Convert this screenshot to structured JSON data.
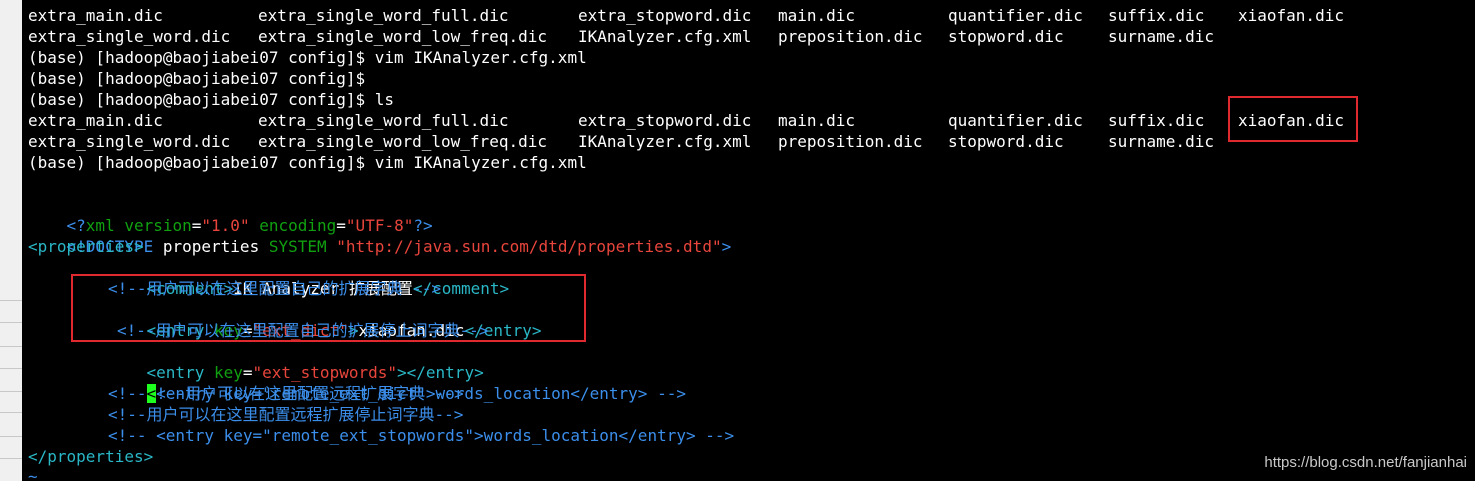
{
  "terminal": {
    "listing_1": {
      "row1": [
        "extra_main.dic",
        "extra_single_word_full.dic",
        "extra_stopword.dic",
        "main.dic",
        "quantifier.dic",
        "suffix.dic",
        "xiaofan.dic"
      ],
      "row2": [
        "extra_single_word.dic",
        "extra_single_word_low_freq.dic",
        "IKAnalyzer.cfg.xml",
        "preposition.dic",
        "stopword.dic",
        "surname.dic"
      ]
    },
    "prompt_1": "(base) [hadoop@baojiabei07 config]$ vim IKAnalyzer.cfg.xml",
    "prompt_2": "(base) [hadoop@baojiabei07 config]$",
    "prompt_3": "(base) [hadoop@baojiabei07 config]$ ls",
    "listing_2": {
      "row1": [
        "extra_main.dic",
        "extra_single_word_full.dic",
        "extra_stopword.dic",
        "main.dic",
        "quantifier.dic",
        "suffix.dic",
        "xiaofan.dic"
      ],
      "row2": [
        "extra_single_word.dic",
        "extra_single_word_low_freq.dic",
        "IKAnalyzer.cfg.xml",
        "preposition.dic",
        "stopword.dic",
        "surname.dic"
      ]
    },
    "prompt_4": "(base) [hadoop@baojiabei07 config]$ vim IKAnalyzer.cfg.xml"
  },
  "vim": {
    "xml_decl": {
      "open": "<?",
      "name": "xml",
      "attr1_name": " version",
      "eq": "=",
      "attr1_value": "\"1.0\"",
      "attr2_name": " encoding",
      "attr2_value": "\"UTF-8\"",
      "close": "?>"
    },
    "doctype": {
      "open": "<!DOCTYPE",
      "text": " properties ",
      "keyword": "SYSTEM",
      "space": " ",
      "url": "\"http://java.sun.com/dtd/properties.dtd\"",
      "close": ">"
    },
    "properties_open": "<properties>",
    "comment_line": {
      "open_tag": "<comment>",
      "text": "IK Analyzer 扩展配置",
      "close_tag": "</comment>"
    },
    "note_ext_dict": "<!--用户可以在这里配置自己的扩展字典 -->",
    "entry_ext_dict": {
      "open": "<entry",
      "key_attr": " key",
      "eq": "=",
      "key_value": "\"ext_dict\"",
      "gt": ">",
      "text": "xiaofan.dic",
      "close": "</entry>"
    },
    "note_ext_stopwords": "<!--用户可以在这里配置自己的扩展停止词字典-->",
    "entry_ext_stopwords": {
      "open": "<entry",
      "key_attr": " key",
      "eq": "=",
      "key_value": "\"ext_stopwords\"",
      "gt": ">",
      "close": "</entry>"
    },
    "cursor_char": "<",
    "note_remote_dict": "!--用户可以在这里配置远程扩展字典 -->",
    "remote_dict_line": "<!-- <entry key=\"remote_ext_dict\">words_location</entry> -->",
    "note_remote_stop": "<!--用户可以在这里配置远程扩展停止词字典-->",
    "remote_stop_line": "<!-- <entry key=\"remote_ext_stopwords\">words_location</entry> -->",
    "properties_close": "</properties>",
    "tilde": "~"
  },
  "watermark": "https://blog.csdn.net/fanjianhai",
  "colors": {
    "background": "#000000",
    "tag": "#3b8eea",
    "attribute": "#10a010",
    "string": "#e8453c",
    "cursor": "#1fff1f",
    "highlight_box": "#e0282f"
  }
}
